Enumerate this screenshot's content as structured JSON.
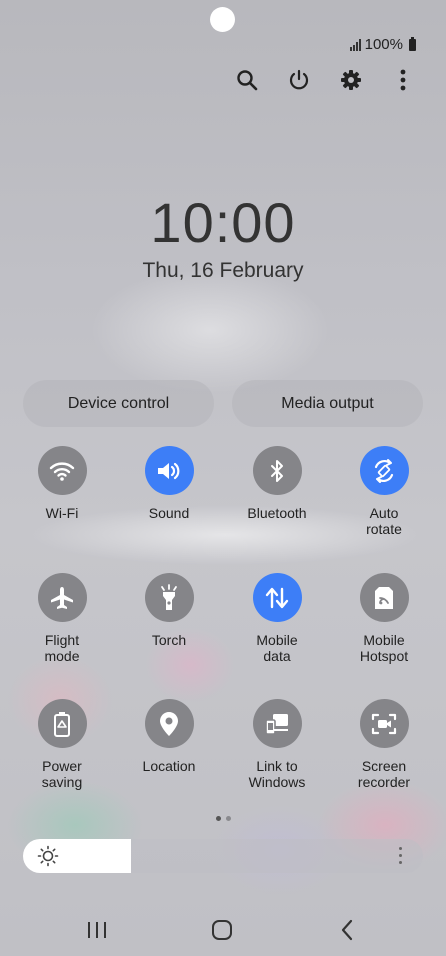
{
  "status": {
    "battery": "100%",
    "icons": [
      "signal-icon",
      "battery-icon"
    ]
  },
  "top_actions": [
    "search-icon",
    "power-icon",
    "settings-icon",
    "more-options-icon"
  ],
  "clock": {
    "time": "10:00",
    "date": "Thu, 16 February"
  },
  "pills": {
    "device_control": "Device control",
    "media_output": "Media output"
  },
  "tiles": [
    {
      "label1": "Wi-Fi",
      "label2": "",
      "icon": "wifi-icon",
      "active": false
    },
    {
      "label1": "Sound",
      "label2": "",
      "icon": "sound-icon",
      "active": true
    },
    {
      "label1": "Bluetooth",
      "label2": "",
      "icon": "bluetooth-icon",
      "active": false
    },
    {
      "label1": "Auto",
      "label2": "rotate",
      "icon": "auto-rotate-icon",
      "active": true
    },
    {
      "label1": "Flight",
      "label2": "mode",
      "icon": "airplane-icon",
      "active": false
    },
    {
      "label1": "Torch",
      "label2": "",
      "icon": "torch-icon",
      "active": false
    },
    {
      "label1": "Mobile",
      "label2": "data",
      "icon": "mobile-data-icon",
      "active": true
    },
    {
      "label1": "Mobile",
      "label2": "Hotspot",
      "icon": "hotspot-icon",
      "active": false
    },
    {
      "label1": "Power",
      "label2": "saving",
      "icon": "power-saving-icon",
      "active": false
    },
    {
      "label1": "Location",
      "label2": "",
      "icon": "location-icon",
      "active": false
    },
    {
      "label1": "Link to Windows",
      "label2": "",
      "icon": "link-to-windows-icon",
      "active": false
    },
    {
      "label1": "Screen recorder",
      "label2": "",
      "icon": "screen-recorder-icon",
      "active": false
    }
  ],
  "pager": {
    "pages": 2,
    "current": 1
  },
  "brightness": {
    "level": 0.27
  },
  "nav": [
    "recent-apps-icon",
    "home-icon",
    "back-icon"
  ],
  "colors": {
    "accent": "#3d7ef7",
    "tile_off": "#858589"
  }
}
